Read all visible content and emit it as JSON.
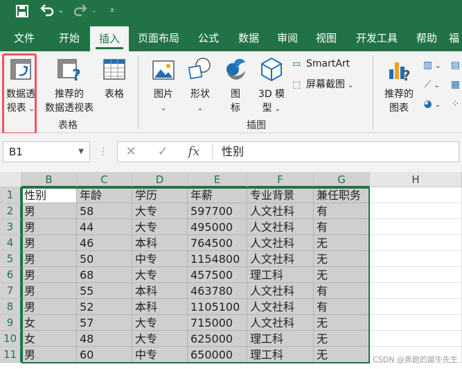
{
  "colors": {
    "excel_green": "#217346",
    "ribbon_bg": "#f3f3f3",
    "highlight_red": "#f0535d",
    "selection_gray": "#cfcfcf"
  },
  "qat": {
    "save_icon": "save-icon",
    "undo_icon": "undo-icon",
    "redo_icon": "redo-icon",
    "customize_icon": "customize-qat-icon"
  },
  "tabs": [
    {
      "label": "文件"
    },
    {
      "label": "开始"
    },
    {
      "label": "插入"
    },
    {
      "label": "页面布局"
    },
    {
      "label": "公式"
    },
    {
      "label": "数据"
    },
    {
      "label": "审阅"
    },
    {
      "label": "视图"
    },
    {
      "label": "开发工具"
    },
    {
      "label": "帮助"
    },
    {
      "label": "福"
    }
  ],
  "active_tab": "插入",
  "ribbon": {
    "pivot_table": {
      "line1": "数据透",
      "line2": "视表"
    },
    "recommended_pivot": {
      "line1": "推荐的",
      "line2": "数据透视表"
    },
    "table": {
      "label": "表格"
    },
    "tables_group": "表格",
    "pictures": {
      "label": "图片"
    },
    "shapes": {
      "label": "形状"
    },
    "icons": {
      "line1": "图",
      "line2": "标"
    },
    "models_3d": {
      "line1": "3D 模",
      "line2": "型"
    },
    "smartart": {
      "label": "SmartArt"
    },
    "screenshot": {
      "label": "屏幕截图"
    },
    "illustrations_group": "插图",
    "recommended_charts": {
      "line1": "推荐的",
      "line2": "图表"
    }
  },
  "formula_bar": {
    "name_box": "B1",
    "fx": "fx",
    "value": "性别"
  },
  "columns": [
    "B",
    "C",
    "D",
    "E",
    "F",
    "G",
    "H"
  ],
  "rows": [
    "1",
    "2",
    "3",
    "4",
    "5",
    "6",
    "7",
    "8",
    "9",
    "10",
    "11"
  ],
  "table": [
    [
      "性别",
      "年龄",
      "学历",
      "年薪",
      "专业背景",
      "兼任职务"
    ],
    [
      "男",
      "58",
      "大专",
      "597700",
      "人文社科",
      "有"
    ],
    [
      "男",
      "44",
      "大专",
      "495000",
      "人文社科",
      "有"
    ],
    [
      "男",
      "46",
      "本科",
      "764500",
      "人文社科",
      "无"
    ],
    [
      "男",
      "50",
      "中专",
      "1154800",
      "人文社科",
      "无"
    ],
    [
      "男",
      "68",
      "大专",
      "457500",
      "理工科",
      "无"
    ],
    [
      "男",
      "55",
      "本科",
      "463780",
      "人文社科",
      "有"
    ],
    [
      "男",
      "52",
      "本科",
      "1105100",
      "人文社科",
      "有"
    ],
    [
      "女",
      "57",
      "大专",
      "715000",
      "人文社科",
      "无"
    ],
    [
      "女",
      "48",
      "大专",
      "625000",
      "理工科",
      "无"
    ],
    [
      "男",
      "60",
      "中专",
      "650000",
      "理工科",
      "无"
    ]
  ],
  "watermark": "CSDN @奔跑的犀牛先生"
}
